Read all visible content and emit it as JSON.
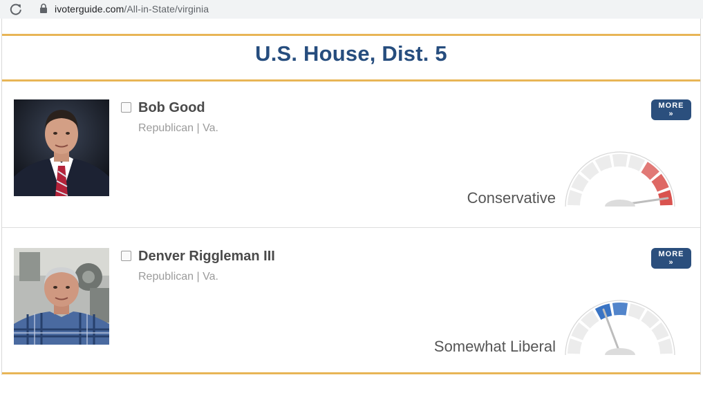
{
  "browser": {
    "url_host": "ivoterguide.com",
    "url_path": "/All-in-State/virginia"
  },
  "race": {
    "title": "U.S. House, Dist. 5"
  },
  "candidates": [
    {
      "name": "Bob Good",
      "party": "Republican | Va.",
      "more_label": "MORE »",
      "rating": "Conservative",
      "gauge_color": "#d9534f",
      "gauge_filled_segments": [
        6,
        7,
        8
      ],
      "gauge_needle_segment": 8
    },
    {
      "name": "Denver Riggleman III",
      "party": "Republican | Va.",
      "more_label": "MORE »",
      "rating": "Somewhat Liberal",
      "gauge_color": "#3a74c4",
      "gauge_filled_segments": [
        3,
        4
      ],
      "gauge_needle_segment": 3
    }
  ]
}
